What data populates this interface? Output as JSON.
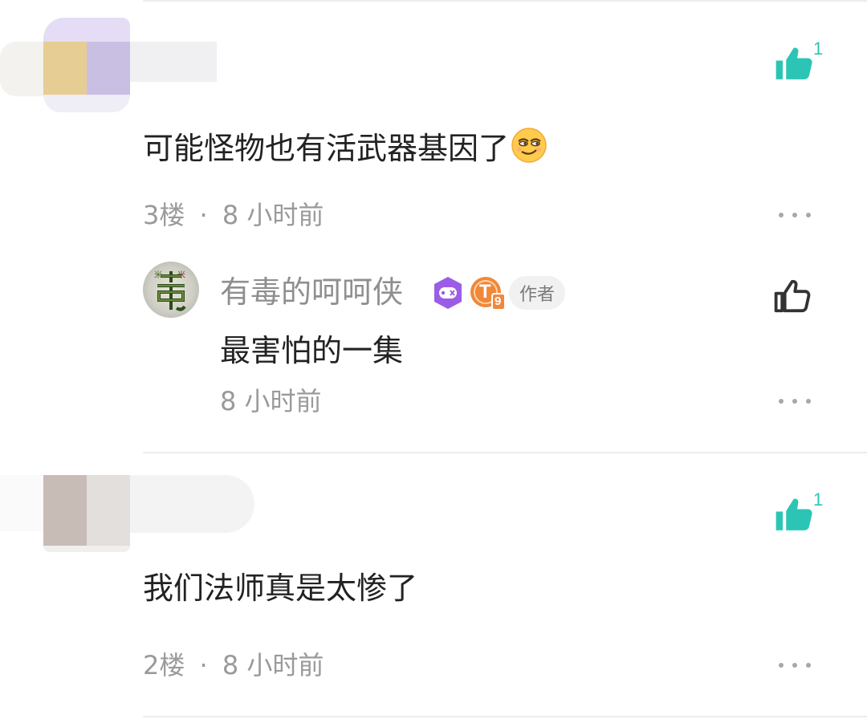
{
  "comments": [
    {
      "text": "可能怪物也有活武器基因了",
      "floor": "3楼",
      "separator": "·",
      "time": "8 小时前",
      "likes": "1",
      "emoji": "smirk-face-emoji",
      "reply": {
        "user": "有毒的呵呵侠",
        "author_badge": "作者",
        "level_badge": "T",
        "level_number": "9",
        "text": "最害怕的一集",
        "time": "8 小时前"
      }
    },
    {
      "text": "我们法师真是太惨了",
      "floor": "2楼",
      "separator": "·",
      "time": "8 小时前",
      "likes": "1"
    }
  ],
  "colors": {
    "accent": "#2cc5b5",
    "text": "#222222",
    "meta": "#9a9a9a",
    "game_badge": "#9b5de5",
    "level_badge": "#f0883a"
  },
  "icons": {
    "like": "thumbs-up-icon",
    "more": "more-dots-icon",
    "game_badge": "game-controller-badge-icon"
  }
}
